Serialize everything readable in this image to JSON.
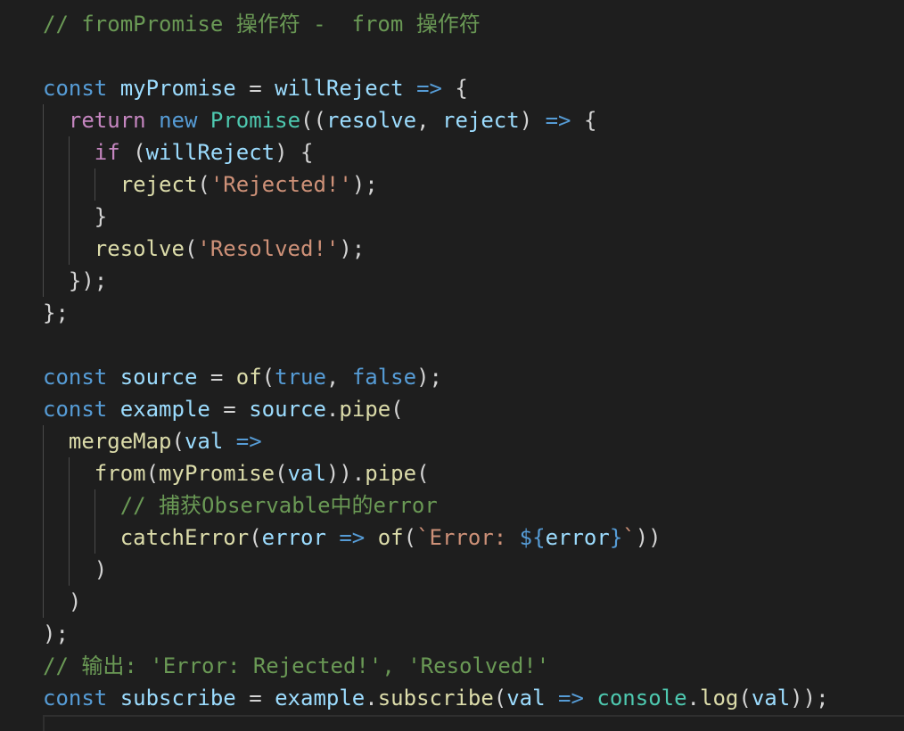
{
  "code": {
    "l1_comment": "// fromPromise 操作符 -  from 操作符",
    "l3_const": "const",
    "l3_name": "myPromise",
    "l3_eq": " = ",
    "l3_param": "willReject",
    "l3_arrow": "=>",
    "l3_brace": " {",
    "l4_return": "return",
    "l4_new": "new",
    "l4_promise": "Promise",
    "l4_open": "((",
    "l4_resolve": "resolve",
    "l4_comma": ", ",
    "l4_reject": "reject",
    "l4_close": ") ",
    "l4_arrow": "=>",
    "l4_brace": " {",
    "l5_if": "if",
    "l5_open": " (",
    "l5_cond": "willReject",
    "l5_close": ") {",
    "l6_fn": "reject",
    "l6_open": "(",
    "l6_str": "'Rejected!'",
    "l6_close": ");",
    "l7_brace": "}",
    "l8_fn": "resolve",
    "l8_open": "(",
    "l8_str": "'Resolved!'",
    "l8_close": ");",
    "l9_close": "});",
    "l10_close": "};",
    "l12_const": "const",
    "l12_name": "source",
    "l12_eq": " = ",
    "l12_fn": "of",
    "l12_open": "(",
    "l12_true": "true",
    "l12_comma": ", ",
    "l12_false": "false",
    "l12_close": ");",
    "l13_const": "const",
    "l13_name": "example",
    "l13_eq": " = ",
    "l13_obj": "source",
    "l13_dot": ".",
    "l13_fn": "pipe",
    "l13_open": "(",
    "l14_fn": "mergeMap",
    "l14_open": "(",
    "l14_param": "val",
    "l14_arrow": "=>",
    "l15_fn": "from",
    "l15_open": "(",
    "l15_inner": "myPromise",
    "l15_open2": "(",
    "l15_arg": "val",
    "l15_close": ")).",
    "l15_pipe": "pipe",
    "l15_open3": "(",
    "l16_comment": "// 捕获Observable中的error",
    "l17_fn": "catchError",
    "l17_open": "(",
    "l17_param": "error",
    "l17_arrow": "=>",
    "l17_of": "of",
    "l17_open2": "(",
    "l17_tpl1": "`Error: ",
    "l17_interp_open": "${",
    "l17_interp_var": "error",
    "l17_interp_close": "}",
    "l17_tpl2": "`",
    "l17_close": "))",
    "l18_close": ")",
    "l19_close": ")",
    "l20_close": ");",
    "l21_comment": "// 输出: 'Error: Rejected!', 'Resolved!'",
    "l22_const": "const",
    "l22_name": "subscribe",
    "l22_eq": " = ",
    "l22_obj": "example",
    "l22_dot": ".",
    "l22_fn": "subscribe",
    "l22_open": "(",
    "l22_param": "val",
    "l22_arrow": "=>",
    "l22_console": "console",
    "l22_dot2": ".",
    "l22_log": "log",
    "l22_open2": "(",
    "l22_arg": "val",
    "l22_close": "));"
  },
  "colors": {
    "background": "#1e1e1e",
    "comment": "#6a9955",
    "keyword": "#569cd6",
    "control": "#c586c0",
    "variable": "#9cdcfe",
    "function": "#dcdcaa",
    "class": "#4ec9b0",
    "string": "#ce9178",
    "punctuation": "#d4d4d4"
  }
}
